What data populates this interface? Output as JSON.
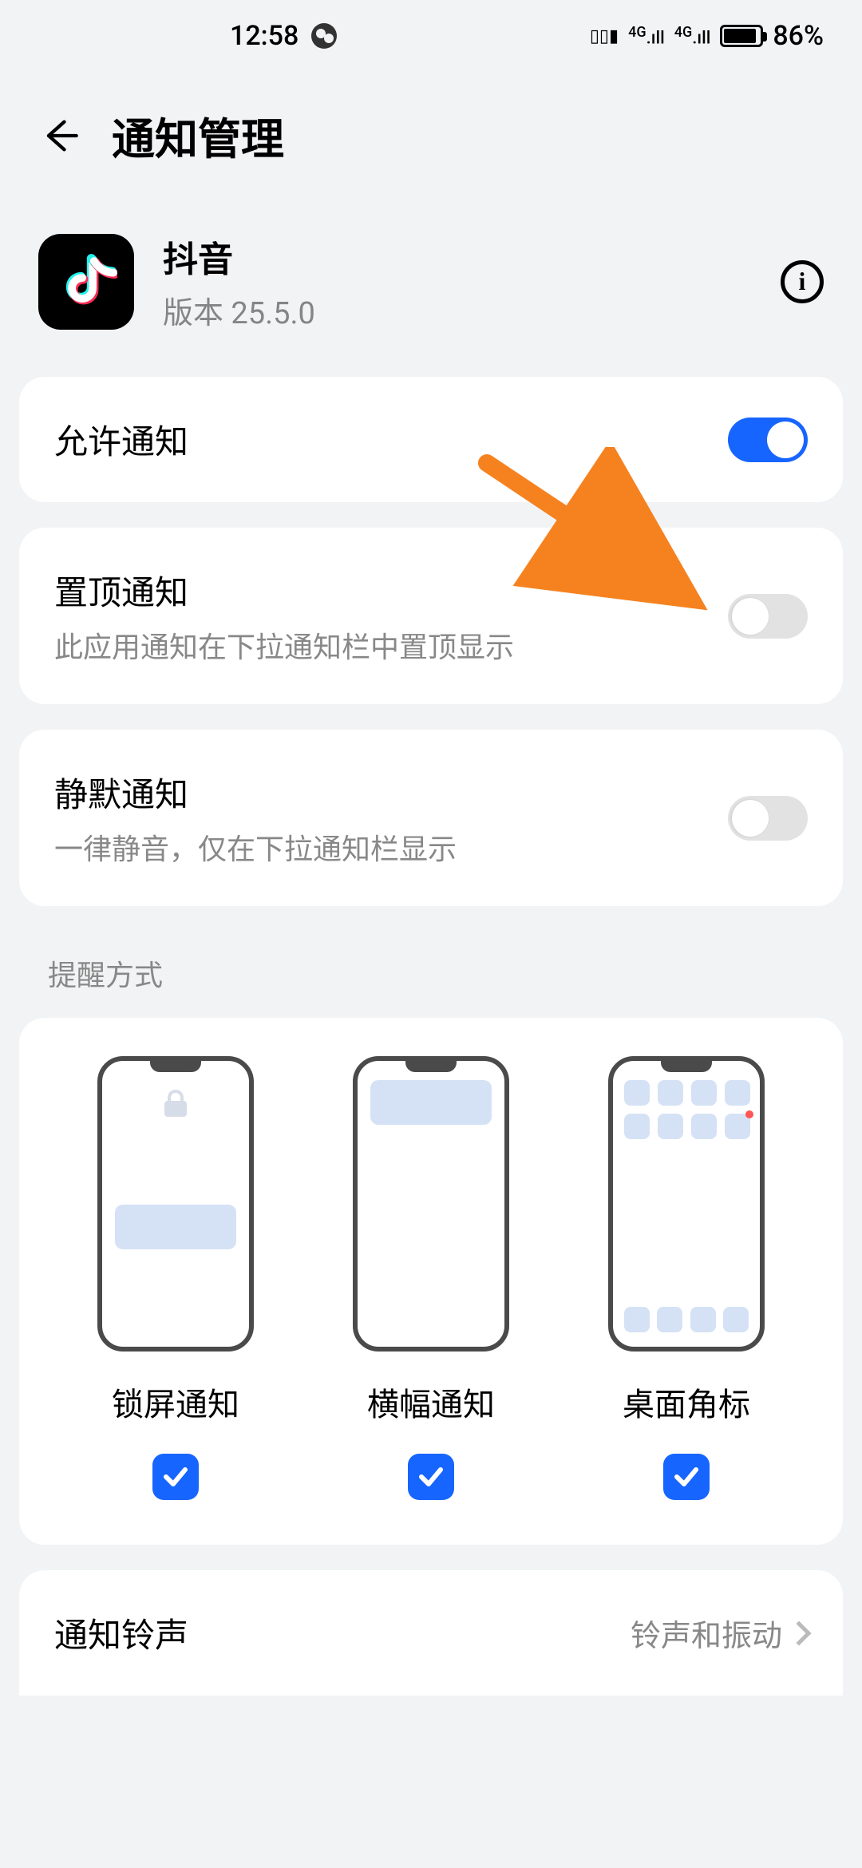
{
  "statusbar": {
    "time": "12:58",
    "battery": "86%"
  },
  "header": {
    "title": "通知管理"
  },
  "app": {
    "name": "抖音",
    "version": "版本 25.5.0"
  },
  "settings": {
    "allow": {
      "label": "允许通知",
      "on": true
    },
    "pin": {
      "label": "置顶通知",
      "sub": "此应用通知在下拉通知栏中置顶显示",
      "on": false
    },
    "silent": {
      "label": "静默通知",
      "sub": "一律静音，仅在下拉通知栏显示",
      "on": false
    }
  },
  "sectionLabel": "提醒方式",
  "modes": {
    "lock": {
      "label": "锁屏通知",
      "checked": true
    },
    "banner": {
      "label": "横幅通知",
      "checked": true
    },
    "badge": {
      "label": "桌面角标",
      "checked": true
    }
  },
  "ringtone": {
    "label": "通知铃声",
    "value": "铃声和振动"
  }
}
